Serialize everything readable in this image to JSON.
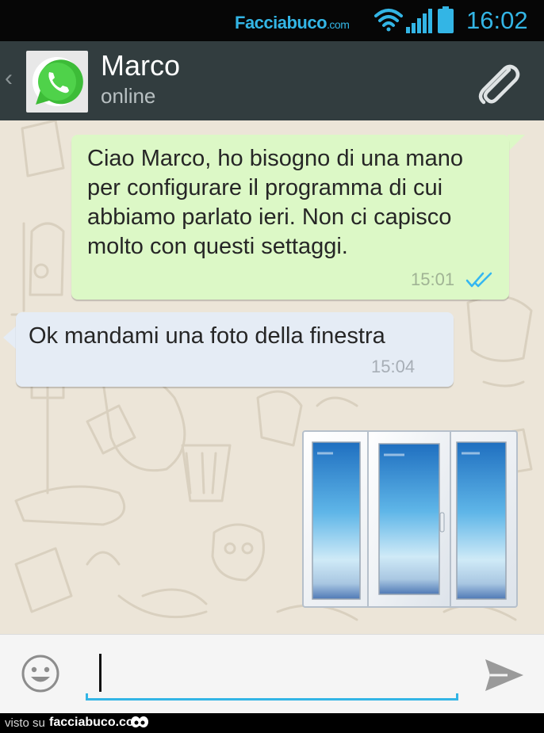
{
  "status_bar": {
    "brand": "Facciabuco",
    "brand_suffix": ".com",
    "time": "16:02",
    "icons": [
      "wifi-icon",
      "signal-icon",
      "battery-icon"
    ],
    "accent_color": "#33b5e5"
  },
  "header": {
    "back_glyph": "‹",
    "contact_name": "Marco",
    "contact_status": "online",
    "avatar_icon": "whatsapp-logo-icon",
    "action_icon": "paperclip-icon",
    "background": "#323d3f"
  },
  "messages": [
    {
      "direction": "outgoing",
      "text": "Ciao Marco, ho bisogno di una mano per configurare il programma di cui abbiamo parlato ieri. Non ci capisco molto con questi settaggi.",
      "time": "15:01",
      "status_icon": "double-check-icon",
      "bubble_color": "#dcf8c6"
    },
    {
      "direction": "incoming",
      "text": "Ok mandami una foto della finestra",
      "time": "15:04",
      "bubble_color": "#e5ecf5"
    },
    {
      "direction": "outgoing",
      "type": "image",
      "image_icon": "window-image"
    }
  ],
  "input_bar": {
    "emoji_icon": "smiley-icon",
    "value": "",
    "send_icon": "send-icon"
  },
  "footer": {
    "prefix": "visto su",
    "site": "facciabuco.com"
  }
}
